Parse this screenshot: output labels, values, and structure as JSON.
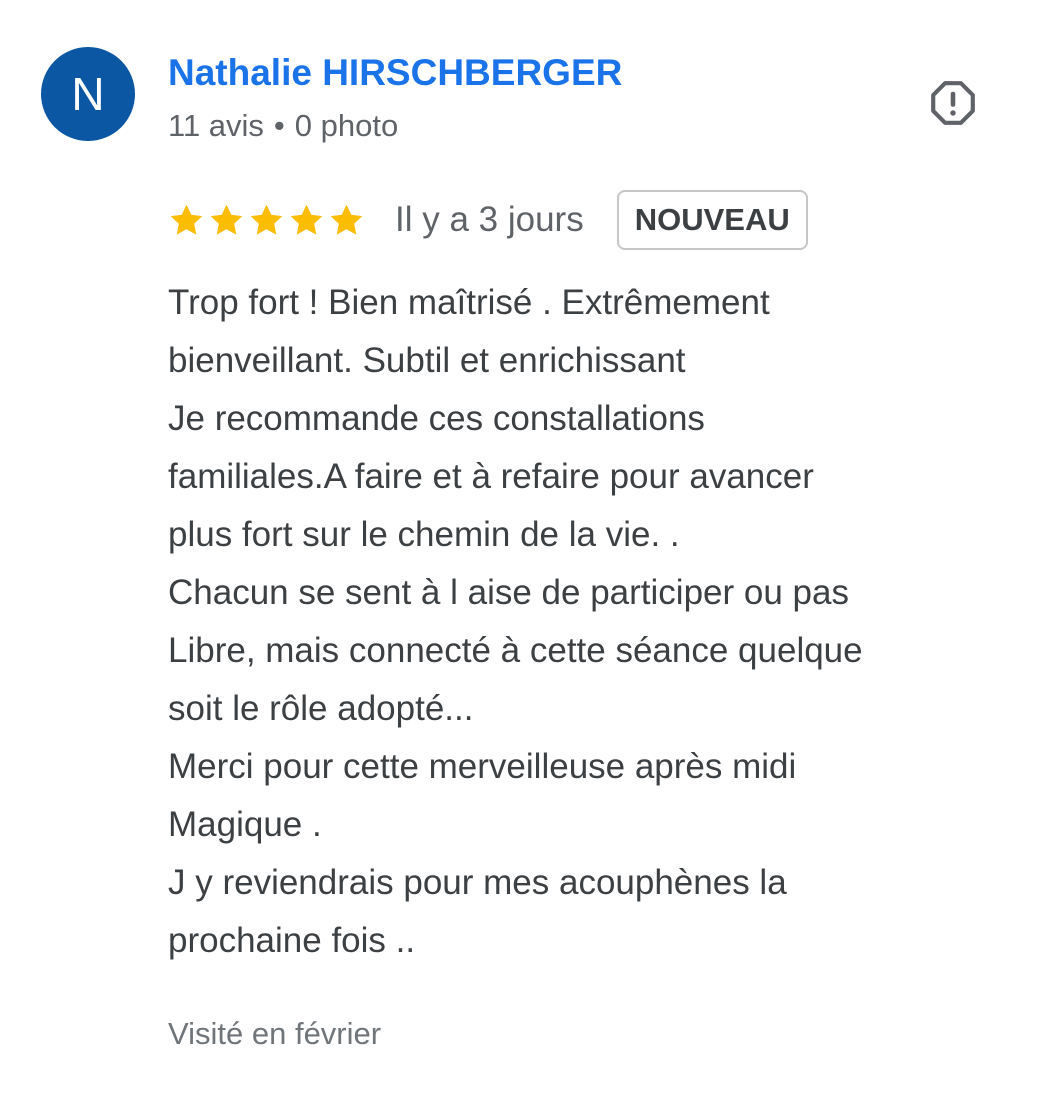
{
  "reviewer": {
    "initial": "N",
    "avatar_color": "#0b57a4",
    "name": "Nathalie HIRSCHBERGER",
    "reviews_count": "11 avis",
    "separator": "•",
    "photos_count": "0 photo"
  },
  "report_icon": "report-flag-octagon-icon",
  "rating": {
    "stars": 5,
    "max_stars": 5,
    "star_color": "#fbbc04"
  },
  "review": {
    "date": "Il y a 3 jours",
    "badge": "NOUVEAU",
    "lines": [
      "Trop fort ! Bien maîtrisé . Extrêmement",
      "bienveillant. Subtil et enrichissant",
      "Je recommande ces constallations",
      "familiales.A faire et à refaire pour avancer",
      "plus fort sur le chemin de la vie. .",
      "Chacun se sent à l aise de participer ou pas",
      "Libre, mais connecté à cette séance quelque",
      "soit le rôle adopté...",
      "Merci pour cette merveilleuse après midi",
      "Magique .",
      "J y reviendrais pour mes acouphènes la",
      "prochaine fois .."
    ],
    "visited": "Visité en février"
  }
}
